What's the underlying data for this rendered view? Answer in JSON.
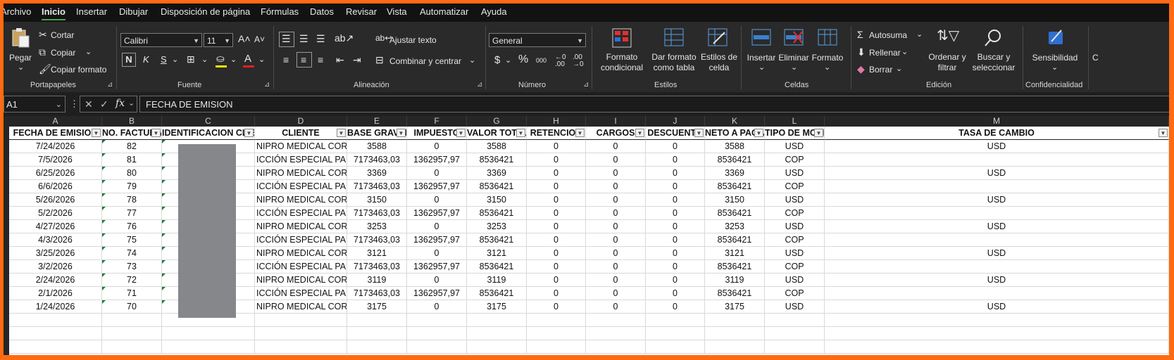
{
  "menu": {
    "tabs": [
      "Archivo",
      "Inicio",
      "Insertar",
      "Dibujar",
      "Disposición de página",
      "Fórmulas",
      "Datos",
      "Revisar",
      "Vista",
      "Automatizar",
      "Ayuda"
    ],
    "active": "Inicio"
  },
  "ribbon": {
    "clipboard": {
      "paste": "Pegar",
      "cut": "Cortar",
      "copy": "Copiar",
      "format_painter": "Copiar formato",
      "label": "Portapapeles"
    },
    "font": {
      "name": "Calibri",
      "size": "11",
      "bold": "N",
      "italic": "K",
      "underline": "S",
      "label": "Fuente"
    },
    "alignment": {
      "wrap": "Ajustar texto",
      "merge": "Combinar y centrar",
      "label": "Alineación"
    },
    "number": {
      "format": "General",
      "currency": "$",
      "percent": "%",
      "thousands": "000",
      "label": "Número"
    },
    "styles": {
      "conditional": "Formato\ncondicional",
      "as_table": "Dar formato\ncomo tabla",
      "cell_styles": "Estilos de\ncelda",
      "label": "Estilos"
    },
    "cells": {
      "insert": "Insertar",
      "delete": "Eliminar",
      "format": "Formato",
      "label": "Celdas"
    },
    "editing": {
      "autosum": "Autosuma",
      "fill": "Rellenar",
      "clear": "Borrar",
      "sort": "Ordenar y\nfiltrar",
      "find": "Buscar y\nseleccionar",
      "label": "Edición"
    },
    "sensitivity": {
      "button": "Sensibilidad",
      "label": "Confidencialidad"
    },
    "trailing": "C"
  },
  "formula_bar": {
    "name_box": "A1",
    "fx": "fx",
    "content": "FECHA DE EMISION"
  },
  "columns": [
    "A",
    "B",
    "C",
    "D",
    "E",
    "F",
    "G",
    "H",
    "I",
    "J",
    "K",
    "L",
    "M"
  ],
  "headers": [
    "FECHA DE EMISION",
    "NO. FACTURA",
    "IDENTIFICACION CLIENTE",
    "CLIENTE",
    "BASE GRAVABLE",
    "IMPUESTO",
    "VALOR TOTAL",
    "RETENCION",
    "CARGOS",
    "DESCUENTO",
    "NETO A PAGAR",
    "TIPO DE MONEDA",
    "TASA DE CAMBIO"
  ],
  "rows": [
    [
      "7/24/2026",
      "82",
      "",
      "NIPRO MEDICAL CORP.",
      "3588",
      "0",
      "3588",
      "0",
      "0",
      "0",
      "3588",
      "USD",
      "USD"
    ],
    [
      "7/5/2026",
      "81",
      "",
      "ICCIÓN ESPECIAL PARA",
      "7173463,03",
      "1362957,97",
      "8536421",
      "0",
      "0",
      "0",
      "8536421",
      "COP",
      ""
    ],
    [
      "6/25/2026",
      "80",
      "",
      "NIPRO MEDICAL CORP.",
      "3369",
      "0",
      "3369",
      "0",
      "0",
      "0",
      "3369",
      "USD",
      "USD"
    ],
    [
      "6/6/2026",
      "79",
      "",
      "ICCIÓN ESPECIAL PARA",
      "7173463,03",
      "1362957,97",
      "8536421",
      "0",
      "0",
      "0",
      "8536421",
      "COP",
      ""
    ],
    [
      "5/26/2026",
      "78",
      "",
      "NIPRO MEDICAL CORP.",
      "3150",
      "0",
      "3150",
      "0",
      "0",
      "0",
      "3150",
      "USD",
      "USD"
    ],
    [
      "5/2/2026",
      "77",
      "",
      "ICCIÓN ESPECIAL PARA",
      "7173463,03",
      "1362957,97",
      "8536421",
      "0",
      "0",
      "0",
      "8536421",
      "COP",
      ""
    ],
    [
      "4/27/2026",
      "76",
      "",
      "NIPRO MEDICAL CORP.",
      "3253",
      "0",
      "3253",
      "0",
      "0",
      "0",
      "3253",
      "USD",
      "USD"
    ],
    [
      "4/3/2026",
      "75",
      "",
      "ICCIÓN ESPECIAL PARA",
      "7173463,03",
      "1362957,97",
      "8536421",
      "0",
      "0",
      "0",
      "8536421",
      "COP",
      ""
    ],
    [
      "3/25/2026",
      "74",
      "",
      "NIPRO MEDICAL CORP.",
      "3121",
      "0",
      "3121",
      "0",
      "0",
      "0",
      "3121",
      "USD",
      "USD"
    ],
    [
      "3/2/2026",
      "73",
      "",
      "ICCIÓN ESPECIAL PARA",
      "7173463,03",
      "1362957,97",
      "8536421",
      "0",
      "0",
      "0",
      "8536421",
      "COP",
      ""
    ],
    [
      "2/24/2026",
      "72",
      "",
      "NIPRO MEDICAL CORP.",
      "3119",
      "0",
      "3119",
      "0",
      "0",
      "0",
      "3119",
      "USD",
      "USD"
    ],
    [
      "2/1/2026",
      "71",
      "",
      "ICCIÓN ESPECIAL PARA",
      "7173463,03",
      "1362957,97",
      "8536421",
      "0",
      "0",
      "0",
      "8536421",
      "COP",
      ""
    ],
    [
      "1/24/2026",
      "70",
      "",
      "NIPRO MEDICAL CORP.",
      "3175",
      "0",
      "3175",
      "0",
      "0",
      "0",
      "3175",
      "USD",
      "USD"
    ]
  ],
  "colors": {
    "accent": "#4aa44a",
    "frame": "#ff6a13",
    "ribbon": "#2a2a2a",
    "redaction": "#86878a"
  }
}
